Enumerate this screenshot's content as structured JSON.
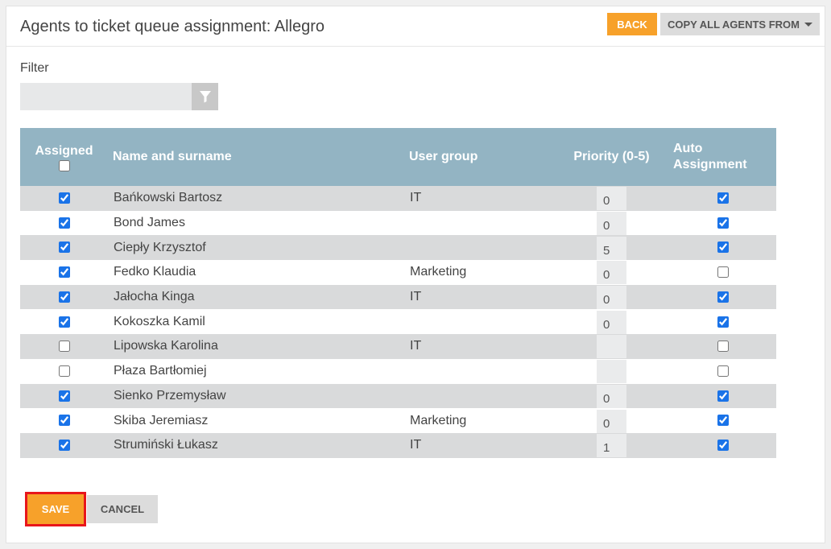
{
  "header": {
    "title": "Agents to ticket queue assignment: Allegro",
    "back_label": "BACK",
    "copy_label": "COPY ALL AGENTS FROM"
  },
  "filter": {
    "label": "Filter",
    "value": "",
    "placeholder": ""
  },
  "table": {
    "headers": {
      "assigned": "Assigned",
      "name": "Name and surname",
      "group": "User group",
      "priority": "Priority (0-5)",
      "auto_line1": "Auto",
      "auto_line2": "Assignment"
    },
    "rows": [
      {
        "assigned": true,
        "name": "Bańkowski Bartosz",
        "group": "IT",
        "priority": "0",
        "auto": true
      },
      {
        "assigned": true,
        "name": "Bond James",
        "group": "",
        "priority": "0",
        "auto": true
      },
      {
        "assigned": true,
        "name": "Ciepły Krzysztof",
        "group": "",
        "priority": "5",
        "auto": true
      },
      {
        "assigned": true,
        "name": "Fedko Klaudia",
        "group": "Marketing",
        "priority": "0",
        "auto": false
      },
      {
        "assigned": true,
        "name": "Jałocha Kinga",
        "group": "IT",
        "priority": "0",
        "auto": true
      },
      {
        "assigned": true,
        "name": "Kokoszka Kamil",
        "group": "",
        "priority": "0",
        "auto": true
      },
      {
        "assigned": false,
        "name": "Lipowska Karolina",
        "group": "IT",
        "priority": "",
        "auto": false
      },
      {
        "assigned": false,
        "name": "Płaza Bartłomiej",
        "group": "",
        "priority": "",
        "auto": false
      },
      {
        "assigned": true,
        "name": "Sienko Przemysław",
        "group": "",
        "priority": "0",
        "auto": true
      },
      {
        "assigned": true,
        "name": "Skiba Jeremiasz",
        "group": "Marketing",
        "priority": "0",
        "auto": true
      },
      {
        "assigned": true,
        "name": "Strumiński Łukasz",
        "group": "IT",
        "priority": "1",
        "auto": true
      }
    ]
  },
  "footer": {
    "save_label": "SAVE",
    "cancel_label": "CANCEL"
  },
  "colors": {
    "accent": "#f7a12a",
    "table_header": "#93b4c3",
    "row_alt": "#d9dadb",
    "highlight_border": "#e8161b"
  },
  "icons": {
    "filter": "filter-funnel-icon",
    "dropdown": "caret-down-icon"
  }
}
